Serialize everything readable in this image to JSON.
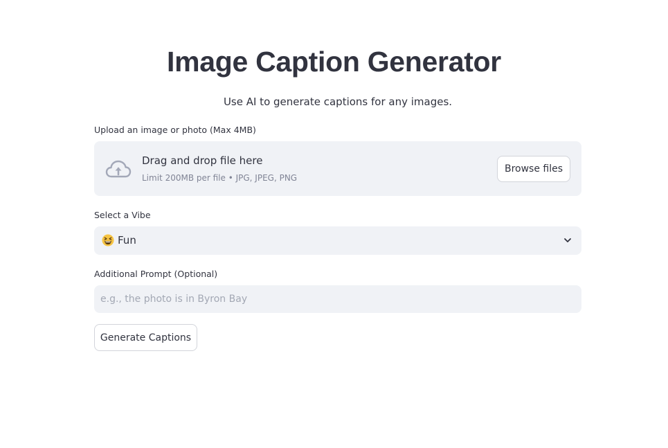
{
  "header": {
    "title": "Image Caption Generator",
    "subtitle": "Use AI to generate captions for any images."
  },
  "upload": {
    "label": "Upload an image or photo (Max 4MB)",
    "dropzone_title": "Drag and drop file here",
    "dropzone_limit": "Limit 200MB per file • JPG, JPEG, PNG",
    "browse_label": "Browse files",
    "icon": "cloud-upload-icon"
  },
  "vibe": {
    "label": "Select a Vibe",
    "selected_emoji": "😆",
    "selected_value": "Fun",
    "icon": "chevron-down-icon"
  },
  "prompt": {
    "label": "Additional Prompt (Optional)",
    "placeholder": "e.g., the photo is in Byron Bay",
    "value": ""
  },
  "actions": {
    "generate_label": "Generate Captions"
  },
  "colors": {
    "text": "#31333f",
    "widget_bg": "#f0f2f6",
    "muted_text": "#808495",
    "border": "#d2d4da"
  }
}
